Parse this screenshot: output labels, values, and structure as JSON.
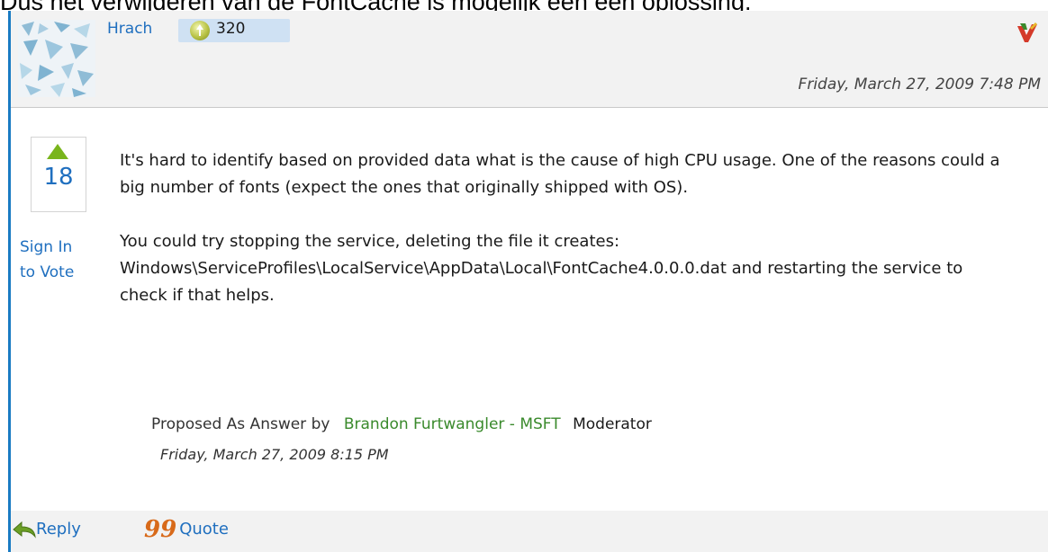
{
  "page_heading": "Dus het verwijderen van de FontCache is mogelijk een een oplossing.",
  "post": {
    "author": "Hrach",
    "points": "320",
    "date": "Friday, March 27, 2009 7:48 PM",
    "votes": "18",
    "sign_in_line1": "Sign In",
    "sign_in_line2": "to Vote",
    "paragraphs": [
      "It's hard to identify based on provided data what is the cause of high CPU usage. One of the reasons could a big number of fonts (expect the ones that originally shipped with OS).",
      "You could try stopping the service, deleting the file it creates: Windows\\ServiceProfiles\\LocalService\\AppData\\Local\\FontCache4.0.0.0.dat and restarting the service to check if that helps."
    ],
    "proposed_prefix": "Proposed As Answer by",
    "proposed_by": "Brandon Furtwangler - MSFT",
    "proposed_role": "Moderator",
    "proposed_date": "Friday, March 27, 2009 8:15 PM"
  },
  "footer": {
    "reply_label": "Reply",
    "quote_label": "Quote"
  },
  "colors": {
    "link": "#1f6fbf",
    "accent_rule": "#1a7bc3",
    "vote_arrow": "#79b51c",
    "moderator_name": "#3a8a2c"
  },
  "icons": [
    "avatar",
    "points-icon",
    "mvp-icon",
    "vote-up-icon",
    "reply-arrow-icon",
    "quote-icon"
  ]
}
